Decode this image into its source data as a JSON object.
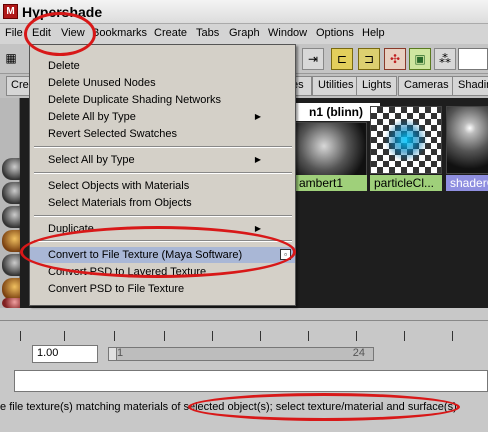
{
  "window": {
    "title": "Hypershade"
  },
  "menubar": [
    "File",
    "Edit",
    "View",
    "Bookmarks",
    "Create",
    "Tabs",
    "Graph",
    "Window",
    "Options",
    "Help"
  ],
  "toolbar": {
    "icons": [
      "arrow-in-icon",
      "graph-input-icon",
      "graph-output-icon",
      "graph-network-icon",
      "graph-selected-icon",
      "graph-clear-icon"
    ]
  },
  "tabs": {
    "create_label": "Cre",
    "labels": [
      "es",
      "Utilities",
      "Lights",
      "Cameras",
      "Shadin"
    ]
  },
  "swatches": {
    "title": "n1 (blinn)",
    "items": [
      {
        "label": "ambert1"
      },
      {
        "label": "particleCl..."
      },
      {
        "label": "shaderGl..."
      }
    ]
  },
  "edit_menu": {
    "items": [
      {
        "label": "Delete"
      },
      {
        "label": "Delete Unused Nodes"
      },
      {
        "label": "Delete Duplicate Shading Networks"
      },
      {
        "label": "Delete All by Type",
        "submenu": true
      },
      {
        "label": "Revert Selected Swatches"
      },
      {
        "label": "Select All by Type",
        "submenu": true
      },
      {
        "label": "Select Objects with Materials"
      },
      {
        "label": "Select Materials from Objects"
      },
      {
        "label": "Duplicate",
        "submenu": true
      },
      {
        "label": "Convert to File Texture (Maya Software)",
        "highlighted": true,
        "option_box": true
      },
      {
        "label": "Convert PSD to Layered Texture"
      },
      {
        "label": "Convert PSD to File Texture"
      }
    ]
  },
  "timeline": {
    "start_field": "1.00",
    "range_start": "1",
    "range_end": "24"
  },
  "help_line": "te file texture(s) matching materials of selected object(s); select texture/material and surface(s)",
  "colors": {
    "annotation": "#d81818",
    "menu_highlight": "#a9b7d6",
    "swatch_label_green": "#9fd07a",
    "swatch_label_blue": "#8f8fe0"
  }
}
